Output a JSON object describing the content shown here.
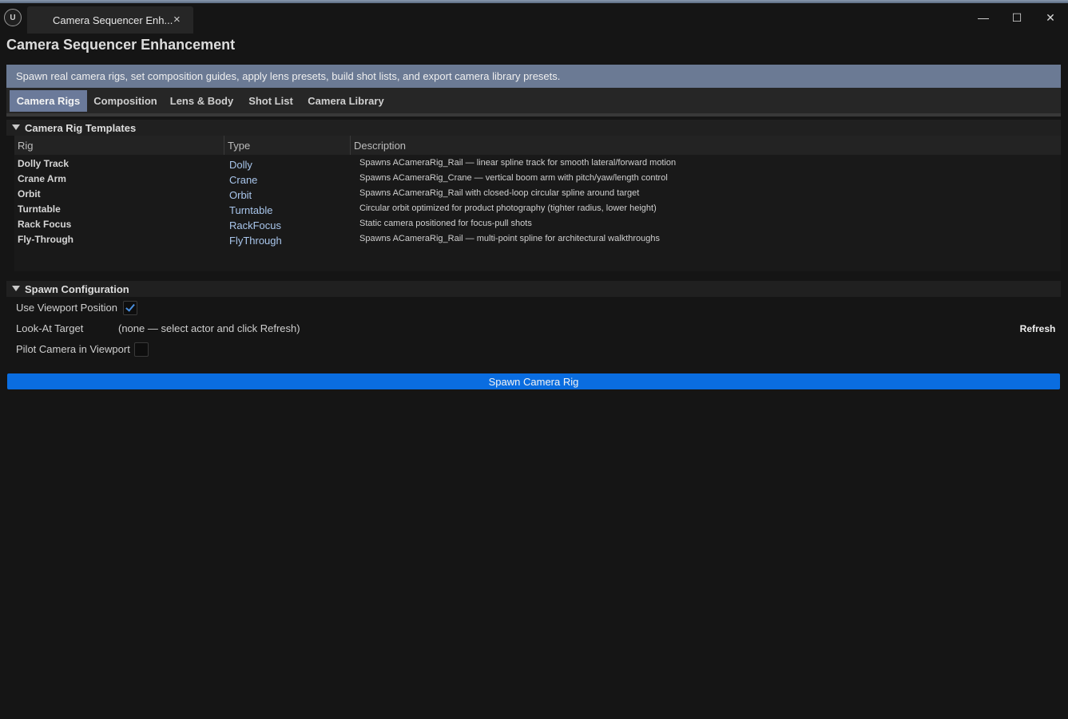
{
  "window": {
    "tab_title": "Camera Sequencer Enh...",
    "tab_close": "×",
    "minimize": "—",
    "maximize": "☐",
    "close": "✕",
    "logo_text": "U"
  },
  "panel": {
    "title": "Camera Sequencer Enhancement",
    "info": "Spawn real camera rigs, set composition guides, apply lens presets, build shot lists, and export camera library presets."
  },
  "tabs": [
    {
      "label": "Camera Rigs",
      "active": true
    },
    {
      "label": "Composition",
      "active": false
    },
    {
      "label": "Lens & Body",
      "active": false
    },
    {
      "label": "Shot List",
      "active": false
    },
    {
      "label": "Camera Library",
      "active": false
    }
  ],
  "templates": {
    "header": "Camera Rig Templates",
    "columns": [
      "Rig",
      "Type",
      "Description"
    ],
    "rows": [
      {
        "rig": "Dolly Track",
        "type": "Dolly",
        "description": "Spawns ACameraRig_Rail — linear spline track for smooth lateral/forward motion"
      },
      {
        "rig": "Crane Arm",
        "type": "Crane",
        "description": "Spawns ACameraRig_Crane — vertical boom arm with pitch/yaw/length control"
      },
      {
        "rig": "Orbit",
        "type": "Orbit",
        "description": "Spawns ACameraRig_Rail with closed-loop circular spline around target"
      },
      {
        "rig": "Turntable",
        "type": "Turntable",
        "description": "Circular orbit optimized for product photography (tighter radius, lower height)"
      },
      {
        "rig": "Rack Focus",
        "type": "RackFocus",
        "description": "Static camera positioned for focus-pull shots"
      },
      {
        "rig": "Fly-Through",
        "type": "FlyThrough",
        "description": "Spawns ACameraRig_Rail — multi-point spline for architectural walkthroughs"
      }
    ]
  },
  "spawn_config": {
    "header": "Spawn Configuration",
    "use_viewport_label": "Use Viewport Position",
    "use_viewport_checked": true,
    "look_at_label": "Look-At Target",
    "look_at_value": "(none — select actor and click Refresh)",
    "refresh_label": "Refresh",
    "pilot_label": "Pilot Camera in Viewport",
    "pilot_checked": false
  },
  "spawn_button": "Spawn Camera Rig",
  "colors": {
    "accent": "#0a6de0",
    "info_bar": "#6b7a94",
    "active_tab": "#6b7a9a",
    "type_text": "#a9c6ec"
  }
}
